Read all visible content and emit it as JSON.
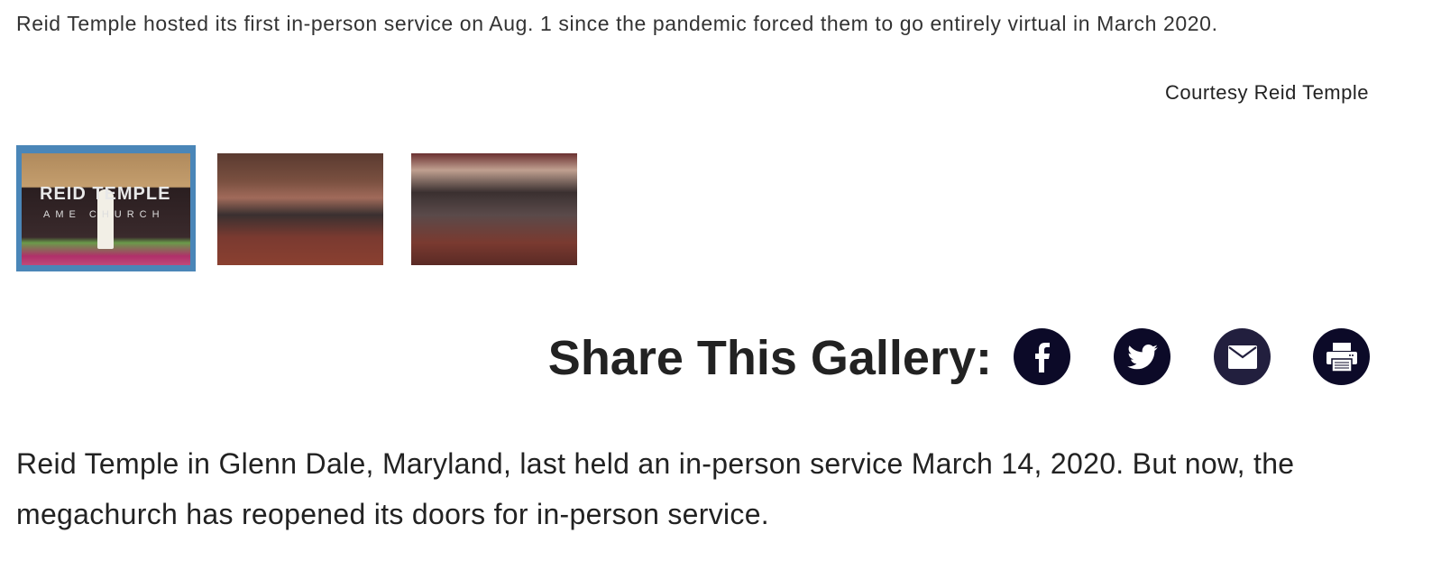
{
  "caption": "Reid Temple hosted its first in-person service on Aug. 1 since the pandemic forced them to go entirely virtual in March 2020.",
  "credit": "Courtesy Reid Temple",
  "gallery": {
    "thumbnails": [
      {
        "alt": "Pastor preaching on stage at Reid Temple",
        "active": true,
        "logo_text": "REID TEMPLE",
        "logo_sub": "AME CHURCH"
      },
      {
        "alt": "Congregants standing in pews raising hands",
        "active": false
      },
      {
        "alt": "Crowd worshipping in sanctuary",
        "active": false
      }
    ],
    "active_border_color": "#4a86b8"
  },
  "share": {
    "title": "Share This Gallery:",
    "icons": [
      "facebook-icon",
      "twitter-icon",
      "email-icon",
      "print-icon"
    ],
    "icon_color": "#0c0a28"
  },
  "article": {
    "paragraph": "Reid Temple in Glenn Dale, Maryland, last held an in-person service March 14, 2020. But now, the megachurch has reopened its doors for in-person service."
  }
}
